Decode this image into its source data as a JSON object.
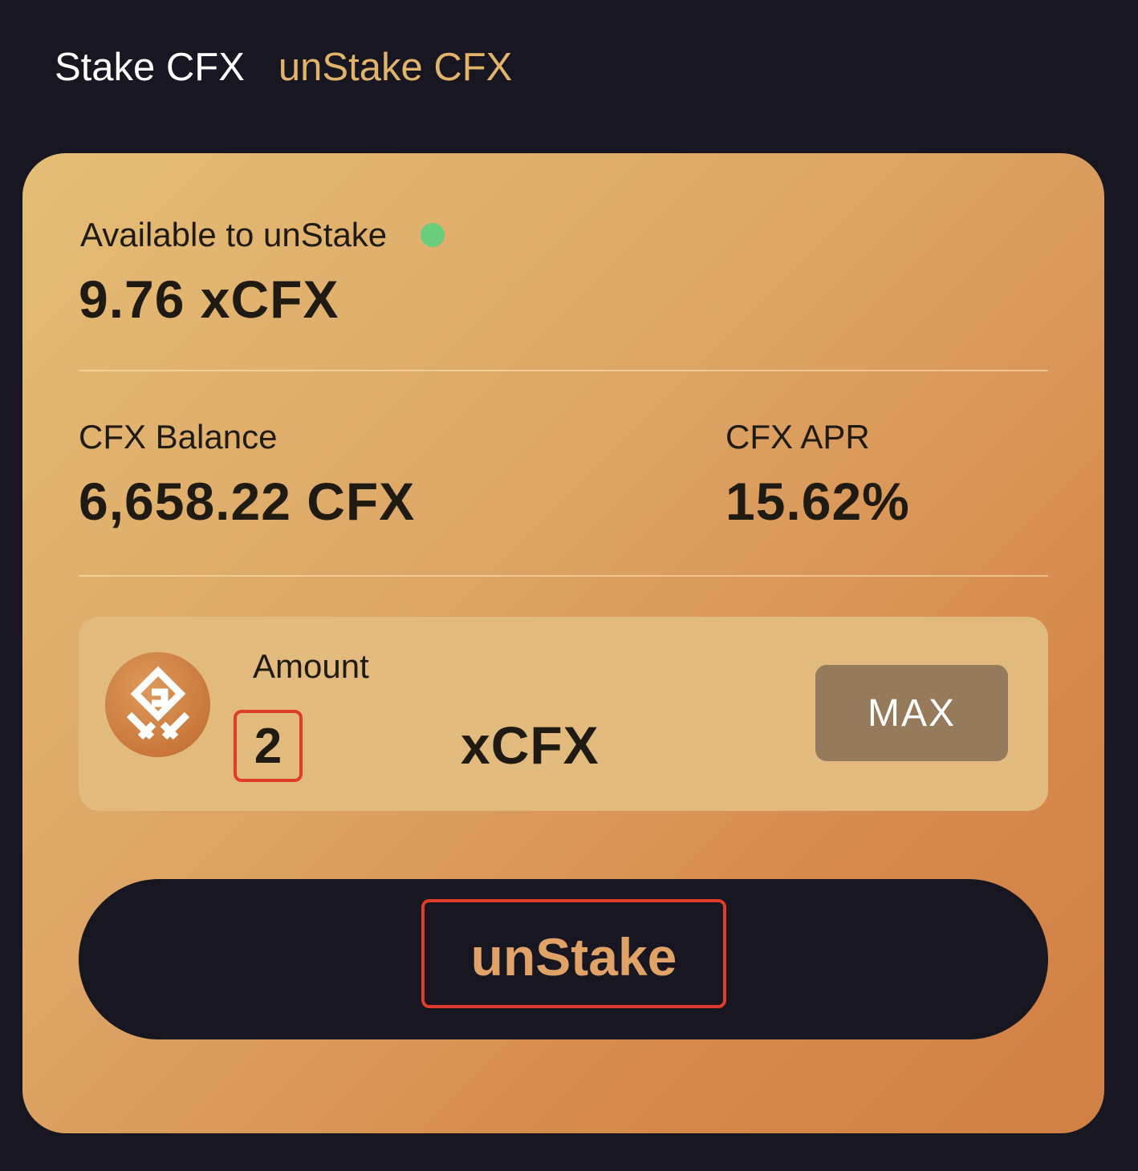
{
  "tabs": {
    "stake": "Stake CFX",
    "unstake": "unStake CFX"
  },
  "card": {
    "available_label": "Available to unStake",
    "available_value": "9.76 xCFX",
    "balance_label": "CFX Balance",
    "balance_value": "6,658.22 CFX",
    "apr_label": "CFX APR",
    "apr_value": "15.62%"
  },
  "amount": {
    "label": "Amount",
    "value": "2",
    "unit": "xCFX",
    "max_label": "MAX",
    "token_icon": "xcfx-token-icon"
  },
  "action": {
    "unstake_label": "unStake"
  },
  "colors": {
    "background": "#171621",
    "tab_active": "#ffffff",
    "tab_accent": "#e2b46b",
    "status_dot": "#6acd7c",
    "max_button": "#957b5c",
    "unstake_text": "#e0a266",
    "highlight_border": "#e03c2a"
  }
}
